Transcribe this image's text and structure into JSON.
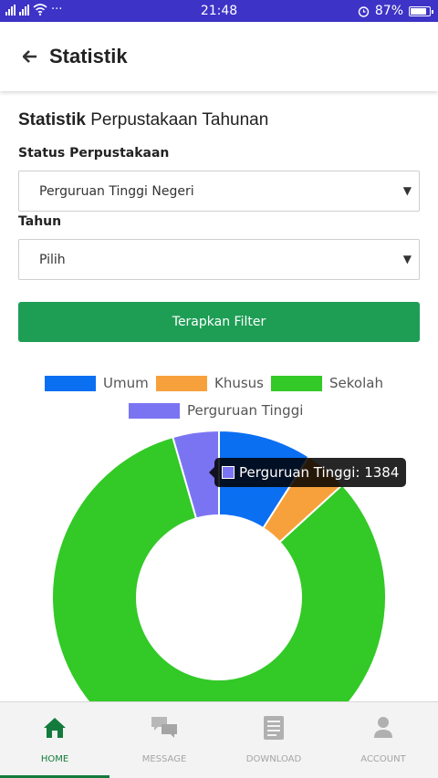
{
  "status_bar": {
    "time": "21:48",
    "battery": "87%",
    "battery_level": 0.87,
    "dots": "···"
  },
  "header": {
    "title": "Statistik"
  },
  "page": {
    "title_bold": "Statistik",
    "title_rest": " Perpustakaan Tahunan",
    "status_label": "Status Perpustakaan",
    "status_value": "Perguruan Tinggi Negeri",
    "year_label": "Tahun",
    "year_value": "Pilih",
    "apply_button": "Terapkan Filter"
  },
  "chart_data": {
    "type": "pie",
    "labels": [
      "Umum",
      "Khusus",
      "Sekolah",
      "Perguruan Tinggi"
    ],
    "values": [
      2800,
      1300,
      25500,
      1384
    ],
    "colors": [
      "#0b6ff2",
      "#f7a13c",
      "#33c927",
      "#7b74f2"
    ],
    "legend": "top",
    "tooltip": "Perguruan Tinggi: 1384"
  },
  "colors": {
    "primary": "#1e9e55",
    "active_nav": "#137b3b",
    "status_bar": "#3d33c7"
  },
  "nav": [
    {
      "label": "HOME",
      "icon": "home-icon",
      "active": true
    },
    {
      "label": "MESSAGE",
      "icon": "message-icon",
      "active": false
    },
    {
      "label": "DOWNLOAD",
      "icon": "download-icon",
      "active": false
    },
    {
      "label": "ACCOUNT",
      "icon": "account-icon",
      "active": false
    }
  ]
}
